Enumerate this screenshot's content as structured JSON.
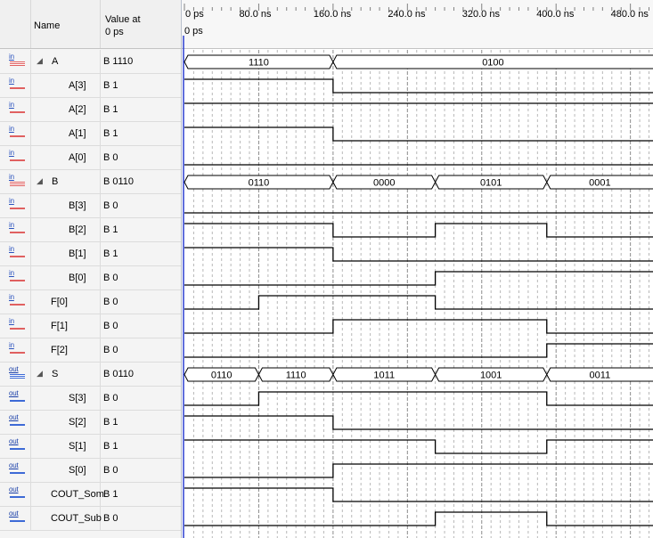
{
  "header": {
    "name_label": "Name",
    "value_label_line1": "Value at",
    "value_label_line2": "0 ps"
  },
  "ruler": {
    "ticks": [
      "0 ps",
      "80.0 ns",
      "160.0 ns",
      "240.0 ns",
      "320.0 ns",
      "400.0 ns",
      "480.0 ns"
    ],
    "cursor_label": "0 ps"
  },
  "signals": [
    {
      "icon": "in",
      "name": "A",
      "value": "B 1110",
      "bus": true,
      "expander": "◢"
    },
    {
      "icon": "in",
      "name": "A[3]",
      "value": "B 1",
      "bus": false
    },
    {
      "icon": "in",
      "name": "A[2]",
      "value": "B 1",
      "bus": false
    },
    {
      "icon": "in",
      "name": "A[1]",
      "value": "B 1",
      "bus": false
    },
    {
      "icon": "in",
      "name": "A[0]",
      "value": "B 0",
      "bus": false
    },
    {
      "icon": "in",
      "name": "B",
      "value": "B 0110",
      "bus": true,
      "expander": "◢"
    },
    {
      "icon": "in",
      "name": "B[3]",
      "value": "B 0",
      "bus": false
    },
    {
      "icon": "in",
      "name": "B[2]",
      "value": "B 1",
      "bus": false
    },
    {
      "icon": "in",
      "name": "B[1]",
      "value": "B 1",
      "bus": false
    },
    {
      "icon": "in",
      "name": "B[0]",
      "value": "B 0",
      "bus": false
    },
    {
      "icon": "in",
      "name": "F[0]",
      "value": "B 0",
      "bus": false
    },
    {
      "icon": "in",
      "name": "F[1]",
      "value": "B 0",
      "bus": false
    },
    {
      "icon": "in",
      "name": "F[2]",
      "value": "B 0",
      "bus": false
    },
    {
      "icon": "out",
      "name": "S",
      "value": "B 0110",
      "bus": true,
      "expander": "◢"
    },
    {
      "icon": "out",
      "name": "S[3]",
      "value": "B 0",
      "bus": false
    },
    {
      "icon": "out",
      "name": "S[2]",
      "value": "B 1",
      "bus": false
    },
    {
      "icon": "out",
      "name": "S[1]",
      "value": "B 1",
      "bus": false
    },
    {
      "icon": "out",
      "name": "S[0]",
      "value": "B 0",
      "bus": false
    },
    {
      "icon": "out",
      "name": "COUT_Som",
      "value": "B 1",
      "bus": false
    },
    {
      "icon": "out",
      "name": "COUT_Sub",
      "value": "B 0",
      "bus": false
    }
  ],
  "icon_labels": {
    "in": "in",
    "out": "out"
  },
  "waveforms": {
    "time_unit": "ns",
    "A_bus": [
      {
        "start": 0,
        "end": 160,
        "label": "1110"
      },
      {
        "start": 160,
        "end": 500,
        "label": "0100"
      }
    ],
    "B_bus": [
      {
        "start": 0,
        "end": 160,
        "label": "0110"
      },
      {
        "start": 160,
        "end": 270,
        "label": "0000"
      },
      {
        "start": 270,
        "end": 390,
        "label": "0101"
      },
      {
        "start": 390,
        "end": 500,
        "label": "0001"
      }
    ],
    "S_bus": [
      {
        "start": 0,
        "end": 80,
        "label": "0110"
      },
      {
        "start": 80,
        "end": 160,
        "label": "1110"
      },
      {
        "start": 160,
        "end": 270,
        "label": "1011"
      },
      {
        "start": 270,
        "end": 390,
        "label": "1001"
      },
      {
        "start": 390,
        "end": 500,
        "label": "0011"
      }
    ],
    "digital": {
      "A[3]": [
        [
          0,
          1
        ],
        [
          160,
          0
        ]
      ],
      "A[2]": [
        [
          0,
          1
        ]
      ],
      "A[1]": [
        [
          0,
          1
        ],
        [
          160,
          0
        ]
      ],
      "A[0]": [
        [
          0,
          0
        ]
      ],
      "B[3]": [
        [
          0,
          0
        ]
      ],
      "B[2]": [
        [
          0,
          1
        ],
        [
          160,
          0
        ],
        [
          270,
          1
        ],
        [
          390,
          0
        ]
      ],
      "B[1]": [
        [
          0,
          1
        ],
        [
          160,
          0
        ]
      ],
      "B[0]": [
        [
          0,
          0
        ],
        [
          270,
          1
        ]
      ],
      "F[0]": [
        [
          0,
          0
        ],
        [
          80,
          1
        ],
        [
          270,
          0
        ]
      ],
      "F[1]": [
        [
          0,
          0
        ],
        [
          160,
          1
        ],
        [
          390,
          0
        ]
      ],
      "F[2]": [
        [
          0,
          0
        ],
        [
          390,
          1
        ]
      ],
      "S[3]": [
        [
          0,
          0
        ],
        [
          80,
          1
        ],
        [
          390,
          0
        ]
      ],
      "S[2]": [
        [
          0,
          1
        ],
        [
          160,
          0
        ]
      ],
      "S[1]": [
        [
          0,
          1
        ],
        [
          270,
          0
        ],
        [
          390,
          1
        ]
      ],
      "S[0]": [
        [
          0,
          0
        ],
        [
          160,
          1
        ]
      ],
      "COUT_Som": [
        [
          0,
          1
        ],
        [
          160,
          0
        ]
      ],
      "COUT_Sub": [
        [
          0,
          0
        ],
        [
          270,
          1
        ],
        [
          390,
          0
        ]
      ]
    }
  },
  "colors": {
    "wave": "#000000",
    "grid": "#9a9a9a",
    "cursor": "#2b3fd1",
    "bus_text": "#000000"
  }
}
